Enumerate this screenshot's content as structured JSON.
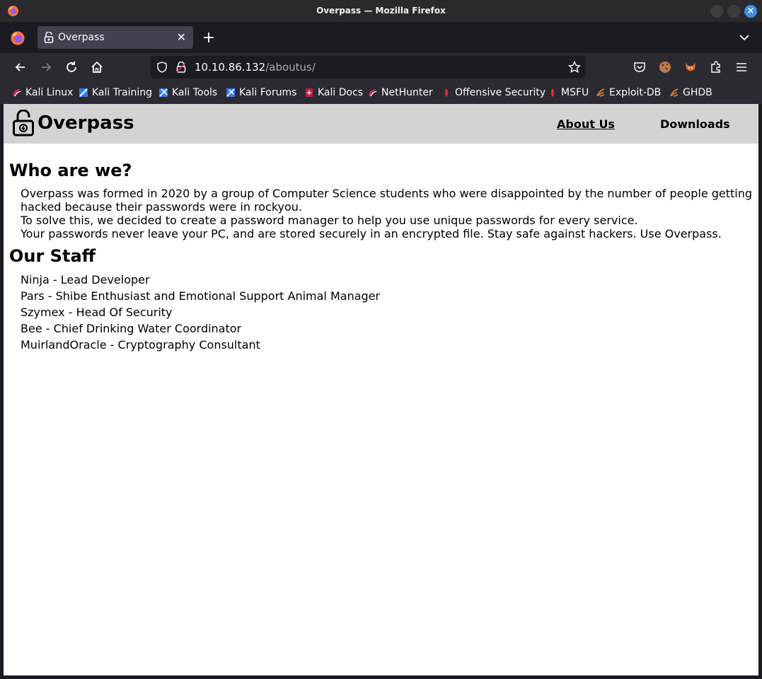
{
  "window": {
    "title": "Overpass — Mozilla Firefox"
  },
  "tabs": [
    {
      "label": "Overpass",
      "active": true
    }
  ],
  "address_bar": {
    "host": "10.10.86.132",
    "path": "/aboutus/"
  },
  "bookmarks": [
    {
      "label": "Kali Linux",
      "icon": "kali-dragon-icon"
    },
    {
      "label": "Kali Training",
      "icon": "kali-training-icon"
    },
    {
      "label": "Kali Tools",
      "icon": "kali-tools-icon"
    },
    {
      "label": "Kali Forums",
      "icon": "kali-forums-icon"
    },
    {
      "label": "Kali Docs",
      "icon": "kali-docs-icon"
    },
    {
      "label": "NetHunter",
      "icon": "kali-dragon-icon"
    },
    {
      "label": "Offensive Security",
      "icon": "offsec-icon"
    },
    {
      "label": "MSFU",
      "icon": "offsec-icon"
    },
    {
      "label": "Exploit-DB",
      "icon": "exploitdb-icon"
    },
    {
      "label": "GHDB",
      "icon": "exploitdb-icon"
    }
  ],
  "site": {
    "name": "Overpass",
    "nav": {
      "about": "About Us",
      "downloads": "Downloads"
    },
    "who_heading": "Who are we?",
    "who_lines": [
      "Overpass was formed in 2020 by a group of Computer Science students who were disappointed by the number of people getting hacked because their passwords were in rockyou.",
      "To solve this, we decided to create a password manager to help you use unique passwords for every service.",
      "Your passwords never leave your PC, and are stored securely in an encrypted file. Stay safe against hackers. Use Overpass."
    ],
    "staff_heading": "Our Staff",
    "staff": [
      "Ninja - Lead Developer",
      "Pars - Shibe Enthusiast and Emotional Support Animal Manager",
      "Szymex - Head Of Security",
      "Bee - Chief Drinking Water Coordinator",
      "MuirlandOracle - Cryptography Consultant"
    ]
  },
  "colors": {
    "chrome_dark": "#1c1b22",
    "toolbar": "#2b2a33",
    "site_header": "#d3d3d3",
    "close_button": "#3d8ee8"
  }
}
